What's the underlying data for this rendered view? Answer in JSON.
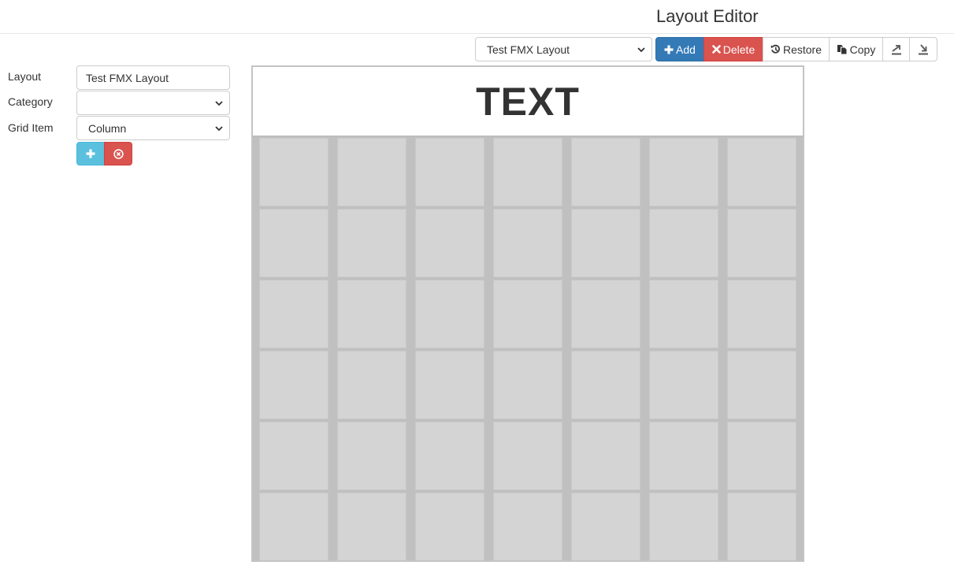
{
  "header": {
    "title": "Layout Editor"
  },
  "toolbar": {
    "layout_select": {
      "selected": "Test FMX Layout",
      "options": [
        "Test FMX Layout"
      ]
    },
    "add_label": "Add",
    "delete_label": "Delete",
    "restore_label": "Restore",
    "copy_label": "Copy",
    "export_icon": "export-icon",
    "import_icon": "import-icon"
  },
  "form": {
    "layout_label": "Layout",
    "layout_value": "Test FMX Layout",
    "category_label": "Category",
    "category_value": "",
    "grid_item_label": "Grid Item",
    "grid_item_value": "Column",
    "grid_item_options": [
      "Column"
    ],
    "add_icon": "plus-icon",
    "remove_icon": "remove-circle-icon"
  },
  "canvas": {
    "text_block": "TEXT",
    "grid": {
      "rows": 6,
      "columns": 7
    }
  },
  "colors": {
    "primary": "#337ab7",
    "danger": "#d9534f",
    "info": "#5bc0de",
    "grid_cell": "#d4d4d4",
    "grid_line": "#c0c0c0"
  }
}
